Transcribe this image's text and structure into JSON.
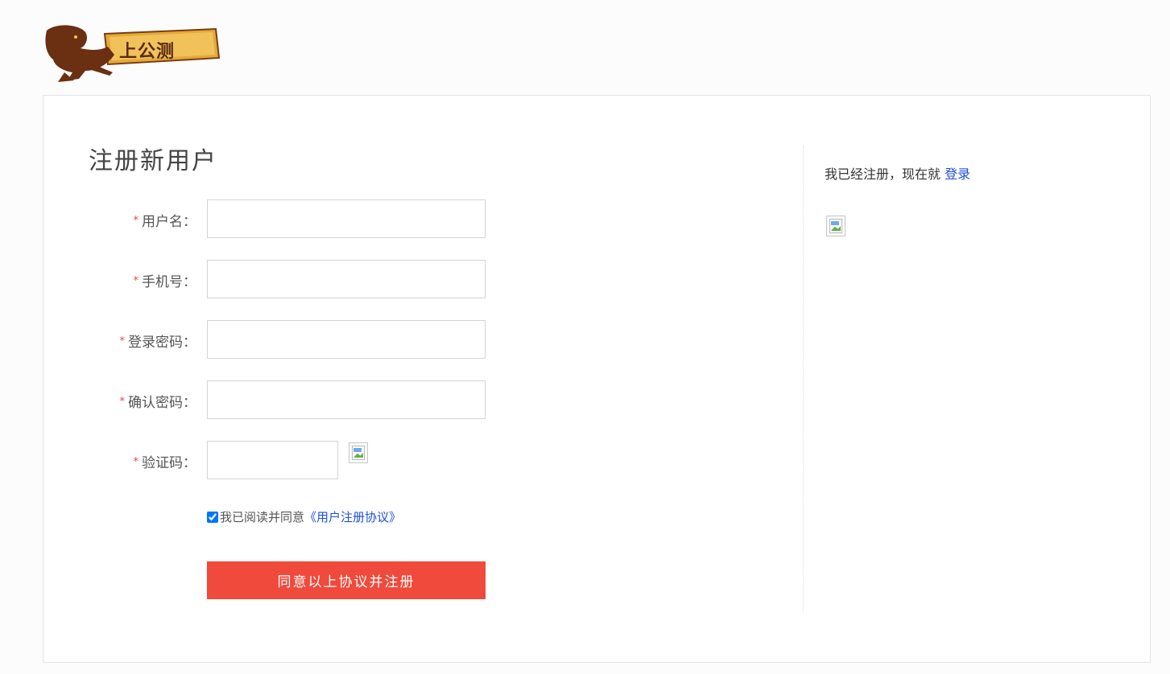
{
  "logo": {
    "text": "上公测"
  },
  "form": {
    "title": "注册新用户",
    "required_mark": "*",
    "fields": [
      {
        "label": "用户名：",
        "value": ""
      },
      {
        "label": "手机号：",
        "value": ""
      },
      {
        "label": "登录密码：",
        "value": ""
      },
      {
        "label": "确认密码：",
        "value": ""
      },
      {
        "label": "验证码：",
        "value": ""
      }
    ],
    "agreement": {
      "checked": true,
      "text": "我已阅读并同意",
      "link": "《用户注册协议》"
    },
    "submit_label": "同意以上协议并注册"
  },
  "sidebar": {
    "hint_text": "我已经注册，现在就",
    "login_link": "登录"
  },
  "colors": {
    "accent": "#ef4a3c",
    "link": "#1e4fd8",
    "required": "#e2483b"
  }
}
